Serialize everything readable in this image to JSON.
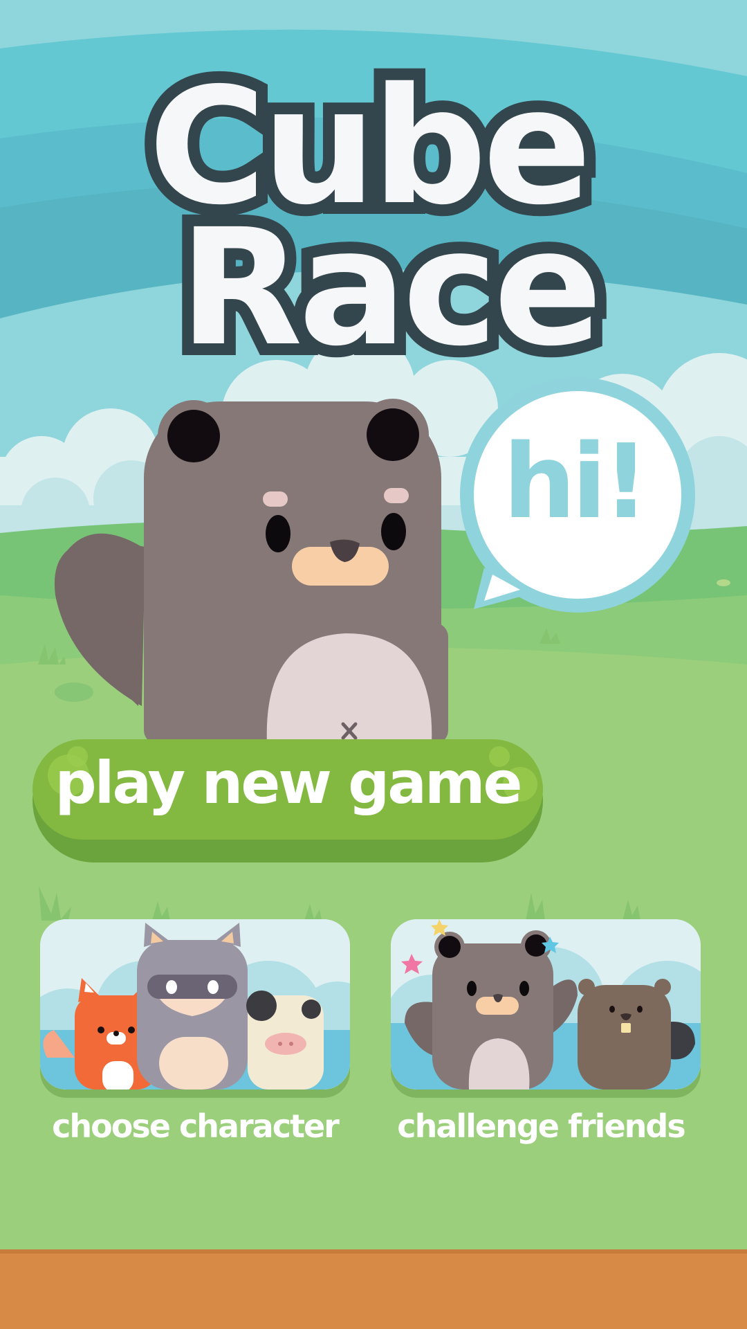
{
  "title": {
    "line1": "Cube",
    "line2": "Race"
  },
  "speech_bubble": {
    "text": "hi!"
  },
  "play_button": {
    "label": "play new game"
  },
  "menu": [
    {
      "label": "choose character",
      "icon": "character-group-icon"
    },
    {
      "label": "challenge friends",
      "icon": "friends-group-icon"
    }
  ],
  "colors": {
    "sky": "#63c8d2",
    "grass": "#9bcf7c",
    "title_outline": "#34464d",
    "button_green": "#83b941",
    "bubble_text": "#8fd3dc",
    "ground": "#d78a46"
  }
}
